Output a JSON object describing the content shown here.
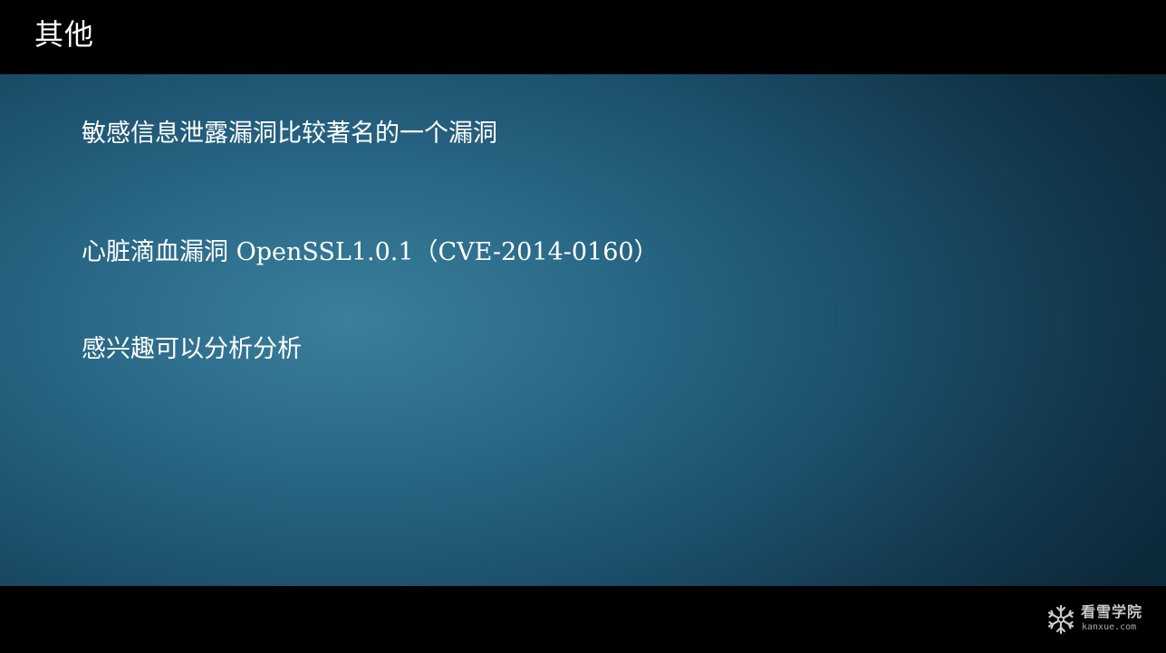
{
  "slide": {
    "title": "其他",
    "lines": [
      "敏感信息泄露漏洞比较著名的一个漏洞",
      "心脏滴血漏洞 OpenSSL1.0.1（CVE-2014-0160）",
      "感兴趣可以分析分析"
    ]
  },
  "footer": {
    "logo_name": "看雪学院",
    "logo_domain": "kanxue.com",
    "logo_icon": "snowflake-icon"
  },
  "colors": {
    "bar_background": "#000000",
    "slide_center": "#3a7f9c",
    "slide_edge": "#0d2a3b",
    "text": "#ffffff"
  }
}
